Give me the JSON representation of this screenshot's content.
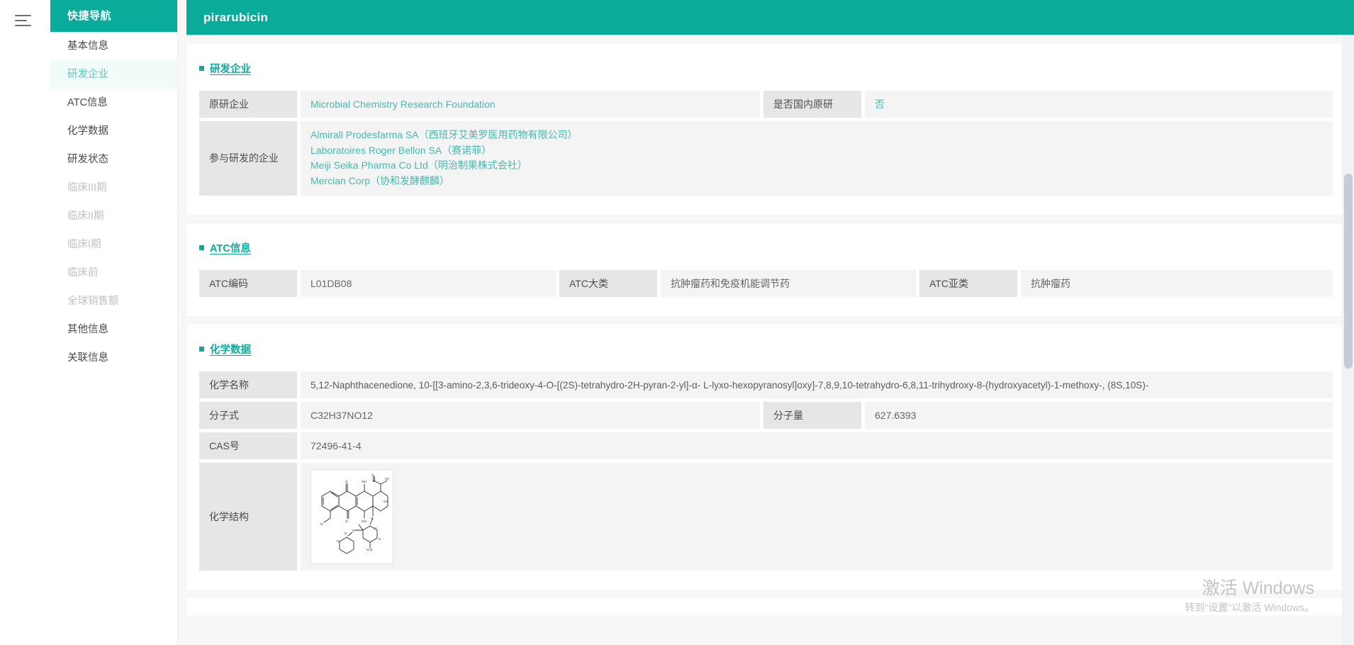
{
  "window": {
    "menu_icon": "hamburger-icon",
    "drug_title": "pirarubicin"
  },
  "sidebar": {
    "title": "快捷导航",
    "items": [
      {
        "label": "基本信息",
        "state": "normal"
      },
      {
        "label": "研发企业",
        "state": "active"
      },
      {
        "label": "ATC信息",
        "state": "normal"
      },
      {
        "label": "化学数据",
        "state": "normal"
      },
      {
        "label": "研发状态",
        "state": "normal"
      },
      {
        "label": "临床III期",
        "state": "disabled"
      },
      {
        "label": "临床II期",
        "state": "disabled"
      },
      {
        "label": "临床I期",
        "state": "disabled"
      },
      {
        "label": "临床前",
        "state": "disabled"
      },
      {
        "label": "全球销售额",
        "state": "disabled"
      },
      {
        "label": "其他信息",
        "state": "normal"
      },
      {
        "label": "关联信息",
        "state": "normal"
      }
    ]
  },
  "sections": {
    "rd_company": {
      "title": "研发企业",
      "originator_label": "原研企业",
      "originator_value": "Microbial Chemistry Research Foundation",
      "domestic_label": "是否国内原研",
      "domestic_value": "否",
      "participants_label": "参与研发的企业",
      "participants": [
        "Almirall Prodesfarma SA（西班牙艾美罗医用药物有限公司）",
        "Laboratoires Roger Bellon SA（赛诺菲）",
        "Meiji Seika Pharma Co Ltd（明治制果株式会社）",
        "Mercian Corp（协和发酵麒麟）"
      ]
    },
    "atc": {
      "title": "ATC信息",
      "code_label": "ATC编码",
      "code_value": "L01DB08",
      "major_label": "ATC大类",
      "major_value": "抗肿瘤药和免疫机能调节药",
      "sub_label": "ATC亚类",
      "sub_value": "抗肿瘤药"
    },
    "chemical": {
      "title": "化学数据",
      "name_label": "化学名称",
      "name_value": "5,12-Naphthacenedione, 10-[[3-amino-2,3,6-trideoxy-4-O-[(2S)-tetrahydro-2H-pyran-2-yl]-α- L-lyxo-hexopyranosyl]oxy]-7,8,9,10-tetrahydro-6,8,11-trihydroxy-8-(hydroxyacetyl)-1-methoxy-, (8S,10S)-",
      "formula_label": "分子式",
      "formula_value": "C32H37NO12",
      "weight_label": "分子量",
      "weight_value": "627.6393",
      "cas_label": "CAS号",
      "cas_value": "72496-41-4",
      "structure_label": "化学结构",
      "structure_icon": "chemical-structure-image"
    }
  },
  "watermark": {
    "line1": "激活 Windows",
    "line2": "转到\"设置\"以激活 Windows。"
  },
  "theme": {
    "accent": "#0bab9b",
    "link": "#44bbaf",
    "key_cell_bg": "#e6e6e6",
    "value_cell_bg": "#f4f4f4"
  }
}
